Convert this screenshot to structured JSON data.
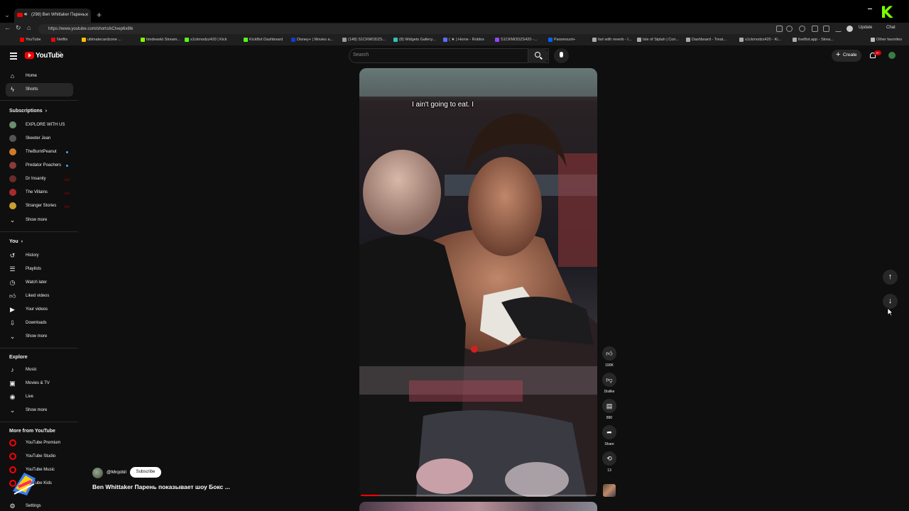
{
  "browser": {
    "tab_title": "(298) Ben Whittaker Парень",
    "url": "https://www.youtube.com/shorts/kCIvep6x8Ik",
    "update_label": "Update",
    "chat_label": "Chat",
    "other_favorites": "Other favorites",
    "bookmarks": [
      {
        "label": "YouTube",
        "color": "#ff0000"
      },
      {
        "label": "Netflix",
        "color": "#e50914"
      },
      {
        "label": "ultimatecardzone ...",
        "color": "#f5c400"
      },
      {
        "label": "timdewski Stream...",
        "color": "#7cff00"
      },
      {
        "label": "s1ckmodzz420 | Kick",
        "color": "#53fc18"
      },
      {
        "label": "KickBot Dashboard",
        "color": "#53fc18"
      },
      {
        "label": "Disney+ | Movies a...",
        "color": "#113ccf"
      },
      {
        "label": "(148) S1CKMODZS...",
        "color": "#999999"
      },
      {
        "label": "(8) Widgets Gallery...",
        "color": "#2ec4b6"
      },
      {
        "label": "( ★ ) Home - Roblox",
        "color": "#5b6cff"
      },
      {
        "label": "S1CKMODZS420 -...",
        "color": "#9146ff"
      },
      {
        "label": "Paramount+",
        "color": "#0064ff"
      },
      {
        "label": "fart with reverb - I...",
        "color": "#aaaaaa"
      },
      {
        "label": "Isle of Siptah | Con...",
        "color": "#aaaaaa"
      },
      {
        "label": "Dashboard - Treat...",
        "color": "#aaaaaa"
      },
      {
        "label": "s1ckmodzz420 - Ki...",
        "color": "#aaaaaa"
      },
      {
        "label": "liveBot.app - Strea...",
        "color": "#aaaaaa"
      }
    ]
  },
  "header": {
    "logo_text": "YouTube",
    "country": "CA",
    "search_placeholder": "Search",
    "create_label": "Create",
    "notif_count": "9+"
  },
  "sidebar": {
    "main": [
      {
        "label": "Home",
        "icon": "home-icon"
      },
      {
        "label": "Shorts",
        "icon": "shorts-icon",
        "active": true
      }
    ],
    "subscriptions_heading": "Subscriptions",
    "subscriptions": [
      {
        "label": "EXPLORE WITH US",
        "color": "#6b8e6b"
      },
      {
        "label": "Skeeter Jean",
        "color": "#555555"
      },
      {
        "label": "TheBurntPeanut",
        "color": "#d07a2a",
        "dot": true
      },
      {
        "label": "Predator Poachers",
        "color": "#8a3a3a",
        "dot": true
      },
      {
        "label": "Dr Insanity",
        "color": "#6a2a2a",
        "live": true
      },
      {
        "label": "The Villains",
        "color": "#aa2a2a",
        "live": true
      },
      {
        "label": "Stranger Stories",
        "color": "#c8a030",
        "live": true
      }
    ],
    "subs_show_more": "Show more",
    "you_heading": "You",
    "you": [
      {
        "label": "History",
        "icon": "history-icon"
      },
      {
        "label": "Playlists",
        "icon": "playlists-icon"
      },
      {
        "label": "Watch later",
        "icon": "watch-later-icon"
      },
      {
        "label": "Liked videos",
        "icon": "liked-videos-icon"
      },
      {
        "label": "Your videos",
        "icon": "your-videos-icon"
      },
      {
        "label": "Downloads",
        "icon": "downloads-icon"
      }
    ],
    "you_show_more": "Show more",
    "explore_heading": "Explore",
    "explore": [
      {
        "label": "Music",
        "icon": "music-icon"
      },
      {
        "label": "Movies & TV",
        "icon": "movies-icon"
      },
      {
        "label": "Live",
        "icon": "live-icon"
      }
    ],
    "explore_show_more": "Show more",
    "more_heading": "More from YouTube",
    "more": [
      {
        "label": "YouTube Premium"
      },
      {
        "label": "YouTube Studio"
      },
      {
        "label": "YouTube Music"
      },
      {
        "label": "YouTube Kids"
      }
    ],
    "settings_label": "Settings"
  },
  "short": {
    "caption": "I ain't going to eat. I",
    "channel": "@Mrqobil",
    "subscribe_label": "Subscribe",
    "title": "Ben Whittaker Парень показывает шоу Бокс ...",
    "progress": 0.08
  },
  "actions": {
    "like_count": "190K",
    "dislike_label": "Dislike",
    "comment_count": "890",
    "share_label": "Share",
    "remix_count": "13"
  },
  "colors": {
    "accent": "#ff0000",
    "background": "#0f0f0f",
    "kick_green": "#7cff00"
  }
}
